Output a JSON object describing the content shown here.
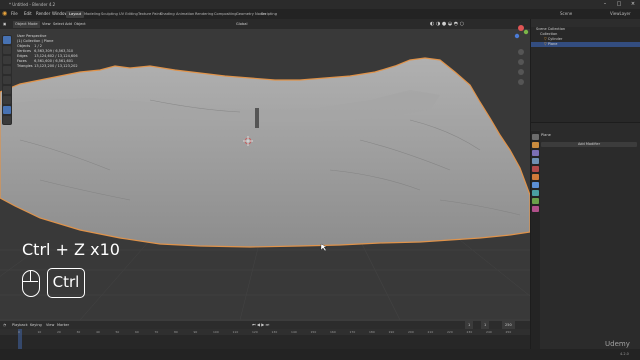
{
  "window": {
    "title": "* Untitled - Blender 4.2"
  },
  "menus": [
    "File",
    "Edit",
    "Render",
    "Window",
    "Help"
  ],
  "workspaces": [
    "Layout",
    "Modeling",
    "Sculpting",
    "UV Editing",
    "Texture Paint",
    "Shading",
    "Animation",
    "Rendering",
    "Compositing",
    "Geometry Nodes",
    "Scripting"
  ],
  "viewport_header": {
    "mode": "Object Mode",
    "menus": [
      "View",
      "Select",
      "Add",
      "Object"
    ],
    "transform": "Global"
  },
  "viewport_info": {
    "perspective": "User Perspective",
    "collection": "(1) Collection | Plane",
    "stats": [
      {
        "label": "Objects",
        "value": "1 / 2"
      },
      {
        "label": "Vertices",
        "value": "6,563,309 / 6,563,310"
      },
      {
        "label": "Edges",
        "value": "13,124,602 / 13,124,606"
      },
      {
        "label": "Faces",
        "value": "6,561,600 / 6,561,601"
      },
      {
        "label": "Triangles",
        "value": "13,123,200 / 13,123,202"
      }
    ]
  },
  "overlay": {
    "shortcut": "Ctrl + Z x10",
    "key_label": "Ctrl",
    "mouse_icon": "mouse-icon"
  },
  "outliner": {
    "rows": [
      {
        "label": "Scene Collection",
        "selected": false
      },
      {
        "label": "Collection",
        "selected": false
      },
      {
        "label": "Cylinder",
        "selected": false
      },
      {
        "label": "Plane",
        "selected": true
      }
    ],
    "scene": "Scene",
    "view_layer": "ViewLayer"
  },
  "properties": {
    "object": "Plane",
    "button": "Add Modifier"
  },
  "timeline": {
    "menus": [
      "Playback",
      "Keying",
      "View",
      "Marker"
    ],
    "current_frame": "1",
    "start": "1",
    "end": "250",
    "ticks": [
      "0",
      "10",
      "20",
      "30",
      "40",
      "50",
      "60",
      "70",
      "80",
      "90",
      "100",
      "110",
      "120",
      "130",
      "140",
      "150",
      "160",
      "170",
      "180",
      "190",
      "200",
      "210",
      "220",
      "230",
      "240",
      "250"
    ]
  },
  "statusbar": {
    "version": "4.2.0"
  },
  "watermark": "Udemy",
  "colors": {
    "accent": "#4772b3",
    "selection_outline": "#e0934a",
    "mesh": "#9a9a9a",
    "background": "#393939"
  }
}
